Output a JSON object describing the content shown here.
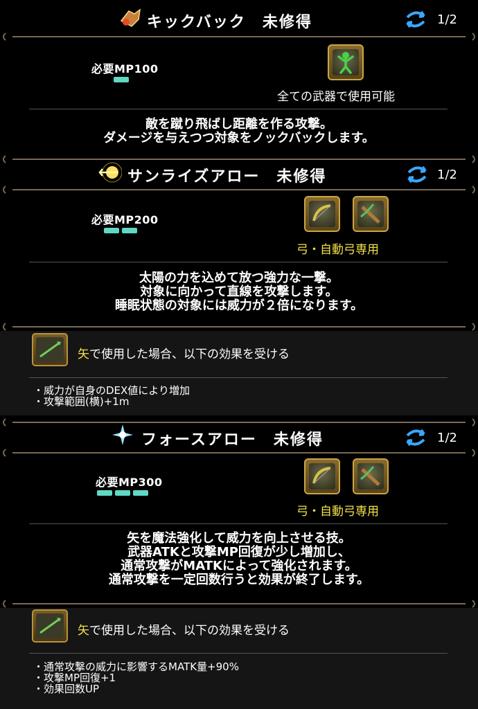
{
  "skills": [
    {
      "icon": "kickback-icon",
      "name": "キックバック　未修得",
      "page": "1/2",
      "mp_label": "必要MP100",
      "mp_pips": 1,
      "weapons": [
        "all-weapons-icon"
      ],
      "availability": "全ての武器で使用可能",
      "desc": [
        "敵を蹴り飛ばし距離を作る攻撃。",
        "ダメージを与えつつ対象をノックバックします。"
      ]
    },
    {
      "icon": "sunrise-arrow-icon",
      "name": "サンライズアロー　未修得",
      "page": "1/2",
      "mp_label": "必要MP200",
      "mp_pips": 2,
      "weapons": [
        "bow-icon",
        "crossbow-icon"
      ],
      "availability": "弓・自動弓専用",
      "desc": [
        "太陽の力を込めて放つ強力な一撃。",
        "対象に向かって直線を攻撃します。",
        "睡眠状態の対象には威力が２倍になります。"
      ],
      "effect": {
        "highlight": "矢",
        "title": "で使用した場合、以下の効果を受ける",
        "bullets": [
          "・威力が自身のDEX値により増加",
          "・攻撃範囲(横)+1m"
        ]
      }
    },
    {
      "icon": "force-arrow-icon",
      "name": "フォースアロー　未修得",
      "page": "1/2",
      "mp_label": "必要MP300",
      "mp_pips": 3,
      "weapons": [
        "bow-icon",
        "crossbow-icon"
      ],
      "availability": "弓・自動弓専用",
      "desc": [
        "矢を魔法強化して威力を向上させる技。",
        "武器ATKと攻撃MP回復が少し増加し、",
        "通常攻撃がMATKによって強化されます。",
        "通常攻撃を一定回数行うと効果が終了します。"
      ],
      "effect": {
        "highlight": "矢",
        "title": "で使用した場合、以下の効果を受ける",
        "bullets": [
          "・通常攻撃の威力に影響するMATK量+90%",
          "・攻撃MP回復+1",
          "・効果回数UP"
        ]
      }
    }
  ],
  "colors": {
    "mp_gauge": "#5fd9c4",
    "highlight": "#f2e04a",
    "frame_gold": "#c9a54a"
  }
}
